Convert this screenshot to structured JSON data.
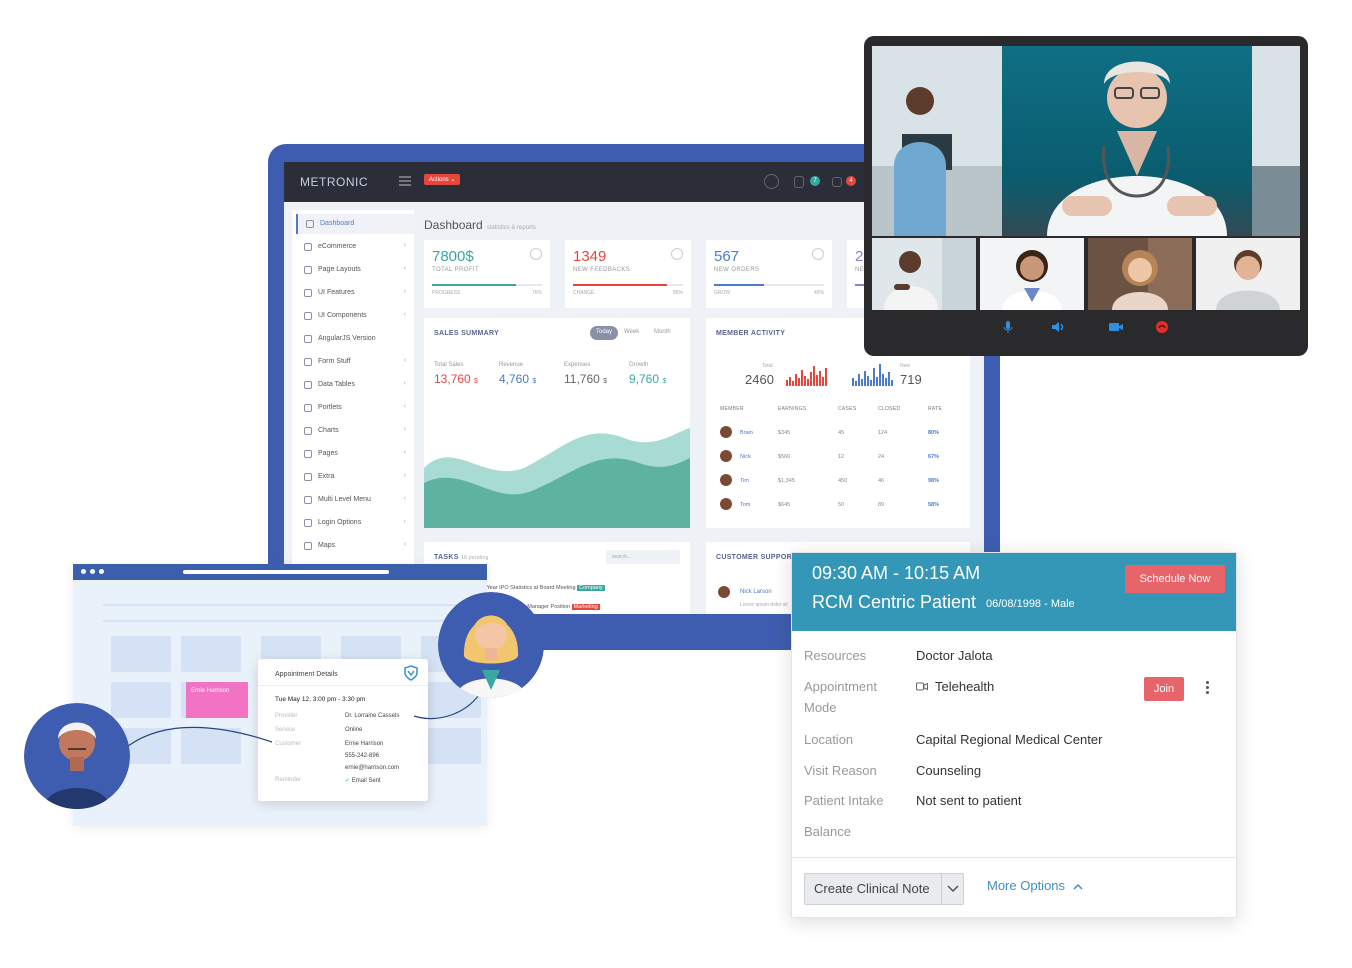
{
  "dashboard": {
    "logo": "METRONIC",
    "actions_label": "Actions ⌄",
    "badge_notif": "7",
    "badge_mail": "4",
    "title": "Dashboard",
    "subtitle": "statistics & reports",
    "sidebar": [
      {
        "label": "Dashboard",
        "chevron": ""
      },
      {
        "label": "eCommerce",
        "chevron": "‹"
      },
      {
        "label": "Page Layouts",
        "chevron": "‹"
      },
      {
        "label": "UI Features",
        "chevron": "‹"
      },
      {
        "label": "UI Components",
        "chevron": "‹"
      },
      {
        "label": "AngularJS Version",
        "chevron": ""
      },
      {
        "label": "Form Stuff",
        "chevron": "‹"
      },
      {
        "label": "Data Tables",
        "chevron": "‹"
      },
      {
        "label": "Portlets",
        "chevron": "‹"
      },
      {
        "label": "Charts",
        "chevron": "‹"
      },
      {
        "label": "Pages",
        "chevron": "‹"
      },
      {
        "label": "Extra",
        "chevron": "‹"
      },
      {
        "label": "Multi Level Menu",
        "chevron": "‹"
      },
      {
        "label": "Login Options",
        "chevron": "‹"
      },
      {
        "label": "Maps",
        "chevron": "‹"
      }
    ],
    "stats": [
      {
        "value": "7800$",
        "label": "TOTAL PROFIT",
        "sub": "PROGRESS",
        "pct": "76%",
        "fill": 0.76,
        "color": "#3aa8a0"
      },
      {
        "value": "1349",
        "label": "NEW FEEDBACKS",
        "sub": "CHANGE",
        "pct": "85%",
        "fill": 0.85,
        "color": "#e5473d"
      },
      {
        "value": "567",
        "label": "NEW ORDERS",
        "sub": "GROW",
        "pct": "45%",
        "fill": 0.45,
        "color": "#4a7bd0"
      },
      {
        "value": "2",
        "label": "NE",
        "sub": "",
        "pct": "",
        "fill": 0.3,
        "color": "#8a7fd0"
      }
    ],
    "sales": {
      "title": "SALES SUMMARY",
      "tabs": [
        "Today",
        "Week",
        "Month"
      ],
      "items": [
        {
          "label": "Total Sales",
          "value": "13,760",
          "unit": "$",
          "color": "#e5473d"
        },
        {
          "label": "Revenue",
          "value": "4,760",
          "unit": "$",
          "color": "#4a7bd0"
        },
        {
          "label": "Expenses",
          "value": "11,760",
          "unit": "$",
          "color": "#666666"
        },
        {
          "label": "Growth",
          "value": "9,760",
          "unit": "$",
          "color": "#3aa8a0"
        }
      ]
    },
    "member": {
      "title": "MEMBER ACTIVITY",
      "total_caption": "Total",
      "total": "2460",
      "new_caption": "New",
      "new": "719",
      "headers": [
        "MEMBER",
        "EARNINGS",
        "CASES",
        "CLOSED",
        "RATE"
      ],
      "rows": [
        {
          "name": "Brain",
          "earnings": "$345",
          "cases": "45",
          "closed": "124",
          "rate": "80%"
        },
        {
          "name": "Nick",
          "earnings": "$560",
          "cases": "12",
          "closed": "24",
          "rate": "67%"
        },
        {
          "name": "Tim",
          "earnings": "$1,345",
          "cases": "450",
          "closed": "46",
          "rate": "98%"
        },
        {
          "name": "Tom",
          "earnings": "$645",
          "cases": "50",
          "closed": "89",
          "rate": "58%"
        }
      ]
    },
    "tasks": {
      "title": "TASKS",
      "pending": "16 pending",
      "search_placeholder": "search...",
      "items": [
        {
          "text": "4 Year IPO Statistics at Board Meeting",
          "tag": "Company"
        },
        {
          "text": "Hire Marketing Manager Position",
          "tag": "Marketing"
        }
      ]
    },
    "support": {
      "title": "CUSTOMER SUPPORT",
      "name": "Nick Larson",
      "text": "Lorem ipsum dolor sit"
    }
  },
  "calendar": {
    "event_name": "Ernie Harrison",
    "appt_title": "Appointment Details",
    "appt_date": "Tue May 12, 3:00 pm - 3:30 pm",
    "fields": [
      {
        "key": "Provider",
        "value": "Dr. Lorraine Cassels"
      },
      {
        "key": "Service",
        "value": "Online"
      },
      {
        "key": "Customer",
        "value": "Ernie Harrison"
      },
      {
        "key": "",
        "value": "555-242-896"
      },
      {
        "key": "",
        "value": "ernie@harrison.com"
      },
      {
        "key": "Reminder",
        "value": "Email Sent"
      }
    ]
  },
  "card": {
    "time": "09:30 AM - 10:15 AM",
    "patient": "RCM Centric Patient",
    "dob": "06/08/1998 - Male",
    "schedule_label": "Schedule Now",
    "resources_label": "Resources",
    "resources_value": "Doctor Jalota",
    "mode_label": "Appointment Mode",
    "mode_value": "Telehealth",
    "join_label": "Join",
    "location_label": "Location",
    "location_value": "Capital Regional Medical Center",
    "reason_label": "Visit Reason",
    "reason_value": "Counseling",
    "intake_label": "Patient Intake",
    "intake_value": "Not sent to patient",
    "balance_label": "Balance",
    "clinical_label": "Create Clinical Note",
    "more_label": "More Options"
  }
}
